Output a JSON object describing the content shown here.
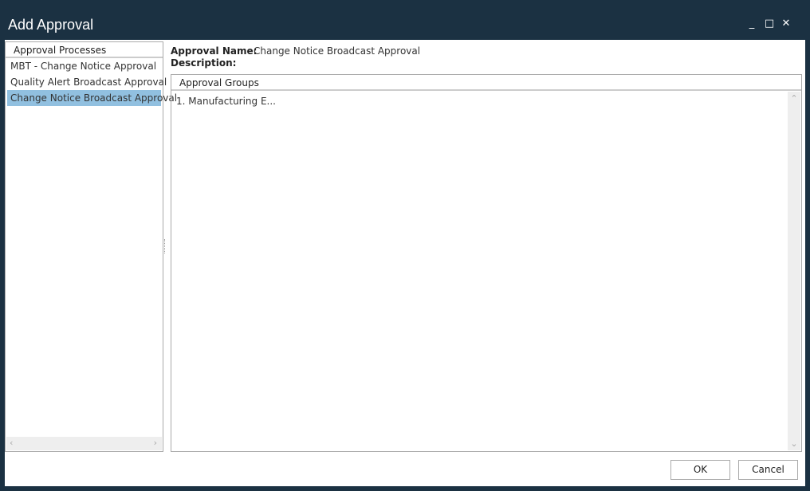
{
  "window": {
    "title": "Add Approval",
    "minimize": "_",
    "maximize": "□",
    "close": "✕"
  },
  "processes": {
    "header": "Approval Processes",
    "items": [
      {
        "label": "MBT - Change Notice Approval"
      },
      {
        "label": "Quality Alert Broadcast Approval"
      },
      {
        "label": "Change Notice Broadcast Approval",
        "selected": true
      }
    ]
  },
  "details": {
    "name_label": "Approval Name:",
    "name_value": "Change Notice Broadcast Approval",
    "description_label": "Description:"
  },
  "groups": {
    "header": "Approval Groups",
    "items": [
      {
        "label": "1. Manufacturing E..."
      }
    ]
  },
  "buttons": {
    "ok": "OK",
    "cancel": "Cancel"
  },
  "colors": {
    "titlebar": "#1b3142",
    "selection": "#91c0e0"
  }
}
